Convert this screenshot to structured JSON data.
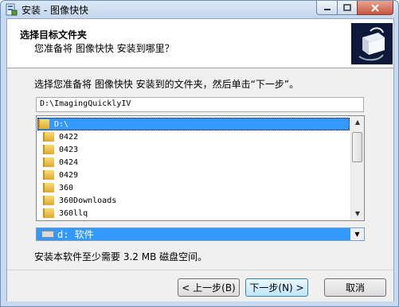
{
  "window": {
    "title": "安装 - 图像快快",
    "icon": "installer-app-icon"
  },
  "header": {
    "title": "选择目标文件夹",
    "subtitle": "您准备将 图像快快 安装到哪里？"
  },
  "instructions": "选择您准备将 图像快快 安装到的文件夹，然后单击“下一步”。",
  "install_path": "D:\\ImagingQuicklyIV",
  "directory_list": {
    "items": [
      "D:\\",
      "0422",
      "0423",
      "0424",
      "0429",
      "360",
      "360Downloads",
      "360llq"
    ],
    "selected_index": 0
  },
  "drive": {
    "selected": "d: 软件"
  },
  "space_required": "安装本软件至少需要 3.2 MB 磁盘空间。",
  "buttons": {
    "back": "< 上一步(B)",
    "next": "下一步(N) >",
    "cancel": "取消"
  },
  "colors": {
    "selection": "#3399ff",
    "title_bar": "#c3d6ee",
    "close_button": "#c7563f"
  }
}
